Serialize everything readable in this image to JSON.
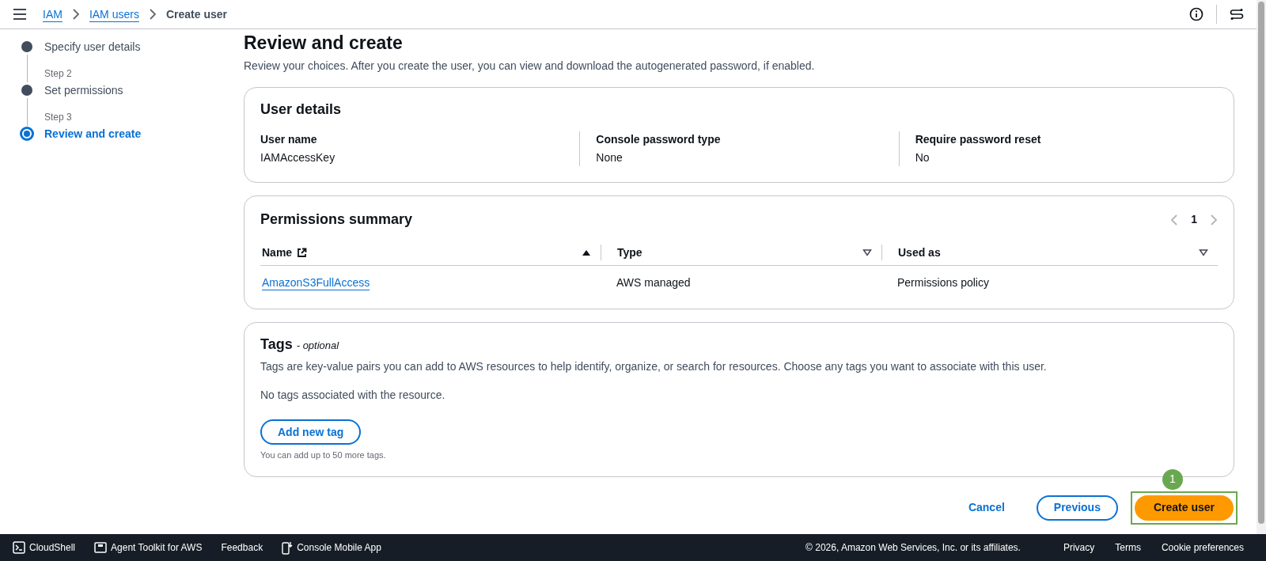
{
  "breadcrumbs": [
    {
      "label": "IAM",
      "link": true
    },
    {
      "label": "IAM users",
      "link": true
    },
    {
      "label": "Create user",
      "link": false
    }
  ],
  "steps": [
    {
      "title": "Specify user details",
      "selected": false
    },
    {
      "label": "Step 2",
      "title": "Set permissions",
      "selected": false
    },
    {
      "label": "Step 3",
      "title": "Review and create",
      "selected": true
    }
  ],
  "page": {
    "title": "Review and create",
    "description": "Review your choices. After you create the user, you can view and download the autogenerated password, if enabled."
  },
  "user_details": {
    "title": "User details",
    "fields": [
      {
        "label": "User name",
        "value": "IAMAccessKey"
      },
      {
        "label": "Console password type",
        "value": "None"
      },
      {
        "label": "Require password reset",
        "value": "No"
      }
    ]
  },
  "permissions": {
    "title": "Permissions summary",
    "page": "1",
    "columns": [
      {
        "kind": "link",
        "label": "Name",
        "sorted": true
      },
      {
        "kind": "plain",
        "label": "Type",
        "sorted": false
      },
      {
        "kind": "plain",
        "label": "Used as",
        "sorted": false
      }
    ],
    "rows": [
      [
        "AmazonS3FullAccess",
        "AWS managed",
        "Permissions policy"
      ]
    ]
  },
  "tags": {
    "title": "Tags",
    "optional": "- optional",
    "description": "Tags are key-value pairs you can add to AWS resources to help identify, organize, or search for resources. Choose any tags you want to associate with this user.",
    "empty": "No tags associated with the resource.",
    "button": "Add new tag",
    "hint": "You can add up to 50 more tags."
  },
  "actions": {
    "cancel": "Cancel",
    "previous": "Previous",
    "create": "Create user",
    "callout": "1"
  },
  "footer": {
    "left": [
      {
        "kind": "cloudshell",
        "label": "CloudShell"
      },
      {
        "kind": "toolkit",
        "label": "Agent Toolkit for AWS"
      },
      {
        "kind": "none",
        "label": "Feedback"
      },
      {
        "kind": "mobile",
        "label": "Console Mobile App"
      }
    ],
    "copyright": "© 2026, Amazon Web Services, Inc. or its affiliates.",
    "links": [
      "Privacy",
      "Terms",
      "Cookie preferences"
    ]
  }
}
